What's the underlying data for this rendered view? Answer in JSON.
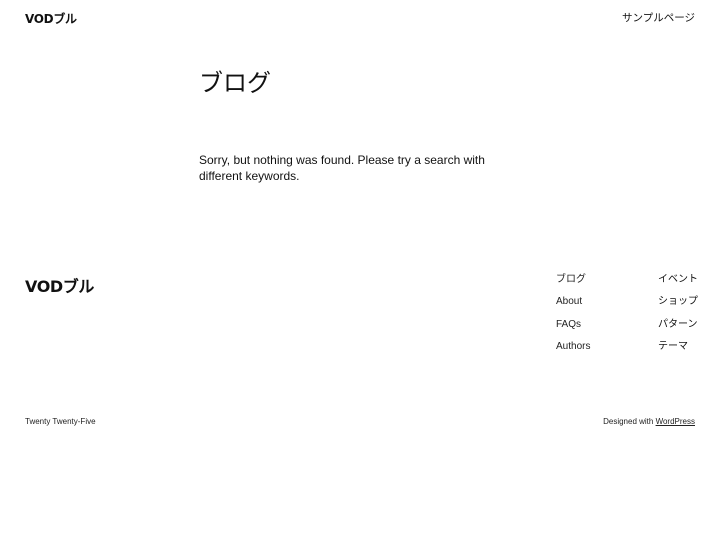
{
  "header": {
    "site_title": "VODブル",
    "nav": [
      {
        "label": "サンプルページ"
      }
    ]
  },
  "main": {
    "title": "ブログ",
    "message": "Sorry, but nothing was found. Please try a search with different keywords."
  },
  "footer": {
    "site_title": "VODブル",
    "nav_col_1": [
      {
        "label": "ブログ"
      },
      {
        "label": "About"
      },
      {
        "label": "FAQs"
      },
      {
        "label": "Authors"
      }
    ],
    "nav_col_2": [
      {
        "label": "イベント"
      },
      {
        "label": "ショップ"
      },
      {
        "label": "パターン"
      },
      {
        "label": "テーマ"
      }
    ],
    "theme_credit": "Twenty Twenty-Five",
    "designed_with_prefix": "Designed with ",
    "designed_with_link": "WordPress"
  }
}
